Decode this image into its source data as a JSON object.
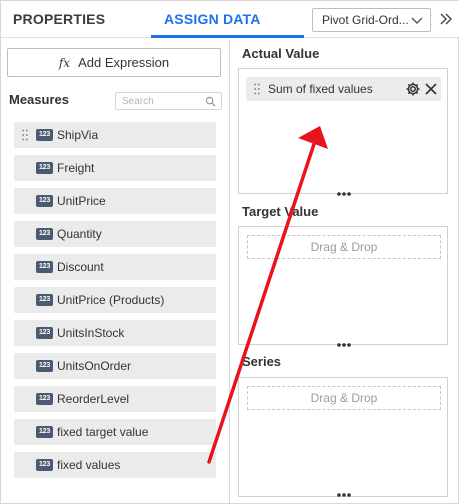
{
  "header": {
    "tabs": [
      {
        "label": "PROPERTIES"
      },
      {
        "label": "ASSIGN DATA"
      }
    ],
    "dropdown_value": "Pivot Grid-Ord...",
    "icons": {
      "dropdown": "chevron-down-icon",
      "collapse": "double-chevron-right-icon"
    }
  },
  "left": {
    "add_expression_icon": "fx",
    "add_expression_label": "Add Expression",
    "measures_label": "Measures",
    "search_placeholder": "Search",
    "type_badge": "123",
    "measures": [
      {
        "label": "ShipVia"
      },
      {
        "label": "Freight"
      },
      {
        "label": "UnitPrice"
      },
      {
        "label": "Quantity"
      },
      {
        "label": "Discount"
      },
      {
        "label": "UnitPrice (Products)"
      },
      {
        "label": "UnitsInStock"
      },
      {
        "label": "UnitsOnOrder"
      },
      {
        "label": "ReorderLevel"
      },
      {
        "label": "fixed target value"
      },
      {
        "label": "fixed values"
      }
    ]
  },
  "right": {
    "actual_value": {
      "title": "Actual Value",
      "item": "Sum of fixed values"
    },
    "target_value": {
      "title": "Target Value",
      "drop_hint": "Drag & Drop"
    },
    "series": {
      "title": "Series",
      "drop_hint": "Drag & Drop"
    }
  },
  "annotation": {
    "color": "#e8141b",
    "meaning": "drag arrow from measure list to Actual Value"
  },
  "colors": {
    "accent": "#1a73e8",
    "badge": "#4a5a70",
    "item_bg": "#ebebeb",
    "arrow": "#e8141b"
  }
}
